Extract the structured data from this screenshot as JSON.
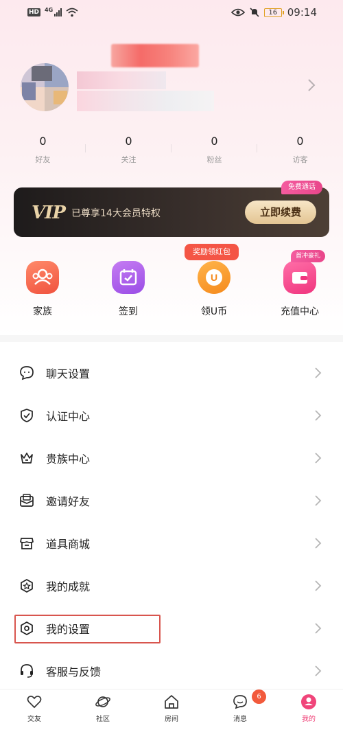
{
  "status_bar": {
    "hd": "HD",
    "network": "4G",
    "battery": "16",
    "time": "09:14"
  },
  "stats": [
    {
      "value": "0",
      "label": "好友"
    },
    {
      "value": "0",
      "label": "关注"
    },
    {
      "value": "0",
      "label": "粉丝"
    },
    {
      "value": "0",
      "label": "访客"
    }
  ],
  "vip": {
    "logo": "VIP",
    "text": "已尊享14大会员特权",
    "button": "立即续费",
    "badge": "免费通话"
  },
  "shortcuts": [
    {
      "label": "家族",
      "icon": "family-icon"
    },
    {
      "label": "签到",
      "icon": "calendar-check-icon"
    },
    {
      "label": "领U币",
      "icon": "ucoin-icon",
      "badge": "奖励领红包"
    },
    {
      "label": "充值中心",
      "icon": "wallet-icon",
      "badge": "首冲豪礼"
    }
  ],
  "ucoin_symbol": "U",
  "menu": [
    {
      "label": "聊天设置",
      "icon": "chat-bubble-icon"
    },
    {
      "label": "认证中心",
      "icon": "shield-check-icon"
    },
    {
      "label": "贵族中心",
      "icon": "crown-icon"
    },
    {
      "label": "邀请好友",
      "icon": "envelope-icon"
    },
    {
      "label": "道具商城",
      "icon": "store-icon"
    },
    {
      "label": "我的成就",
      "icon": "achievement-hexagon-icon"
    },
    {
      "label": "我的设置",
      "icon": "settings-hexagon-icon"
    },
    {
      "label": "客服与反馈",
      "icon": "headset-icon"
    }
  ],
  "bottom_nav": [
    {
      "label": "交友",
      "icon": "heart-icon"
    },
    {
      "label": "社区",
      "icon": "planet-icon"
    },
    {
      "label": "房间",
      "icon": "home-icon"
    },
    {
      "label": "消息",
      "icon": "message-icon",
      "badge": "6"
    },
    {
      "label": "我的",
      "icon": "profile-icon",
      "active": true
    }
  ],
  "colors": {
    "accent": "#f0457a",
    "highlight_border": "#d8554e",
    "vip_gold": "#e9d3a8"
  }
}
